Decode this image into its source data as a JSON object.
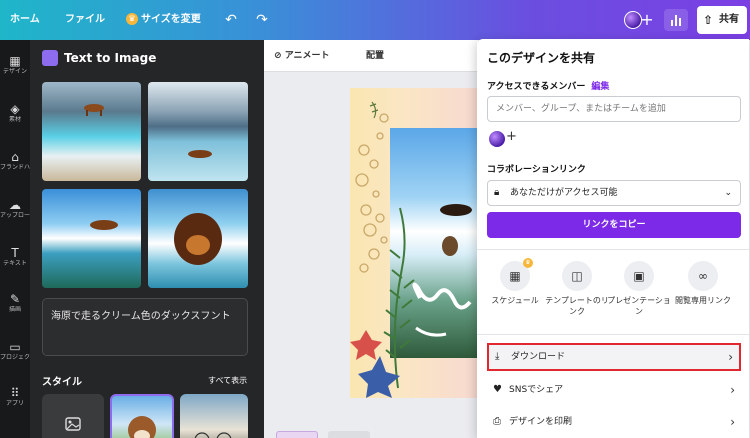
{
  "topbar": {
    "home": "ホーム",
    "file": "ファイル",
    "resize": "サイズを変更",
    "share": "共有",
    "undo_icon": "undo-icon",
    "redo_icon": "redo-icon",
    "gradient_colors": [
      "#1fb6c9",
      "#7b3fe4"
    ]
  },
  "leftnav": {
    "items": [
      {
        "label": "デザイン",
        "icon": "layout-icon"
      },
      {
        "label": "素材",
        "icon": "elements-icon"
      },
      {
        "label": "ブランドハブ",
        "icon": "brand-icon"
      },
      {
        "label": "アップロード",
        "icon": "upload-icon"
      },
      {
        "label": "テキスト",
        "icon": "text-icon"
      },
      {
        "label": "描画",
        "icon": "draw-icon"
      },
      {
        "label": "プロジェクト",
        "icon": "folder-icon"
      },
      {
        "label": "アプリ",
        "icon": "apps-icon"
      }
    ]
  },
  "panel": {
    "title": "Text to Image",
    "prompt": "海原で走るクリーム色のダックスフント",
    "style_label": "スタイル",
    "see_all": "すべて表示"
  },
  "canvas_toolbar": {
    "animate": "アニメート",
    "position": "配置"
  },
  "share": {
    "title": "このデザインを共有",
    "access_label": "アクセスできるメンバー",
    "edit": "編集",
    "member_placeholder": "メンバー、グループ、またはチームを追加",
    "collab_label": "コラボレーションリンク",
    "access_value": "あなただけがアクセス可能",
    "copy_link": "リンクをコピー",
    "options": [
      {
        "label": "スケジュール",
        "icon": "calendar-icon"
      },
      {
        "label": "テンプレートのリンク",
        "icon": "template-icon"
      },
      {
        "label": "プレゼンテーション",
        "icon": "present-icon"
      },
      {
        "label": "閲覧専用リンク",
        "icon": "link-icon"
      }
    ],
    "rows": [
      {
        "label": "ダウンロード",
        "icon": "download-icon"
      },
      {
        "label": "SNSでシェア",
        "icon": "heart-icon"
      },
      {
        "label": "デザインを印刷",
        "icon": "print-icon"
      }
    ],
    "accent": "#7d2ae8",
    "highlight_border": "#e0282e"
  }
}
